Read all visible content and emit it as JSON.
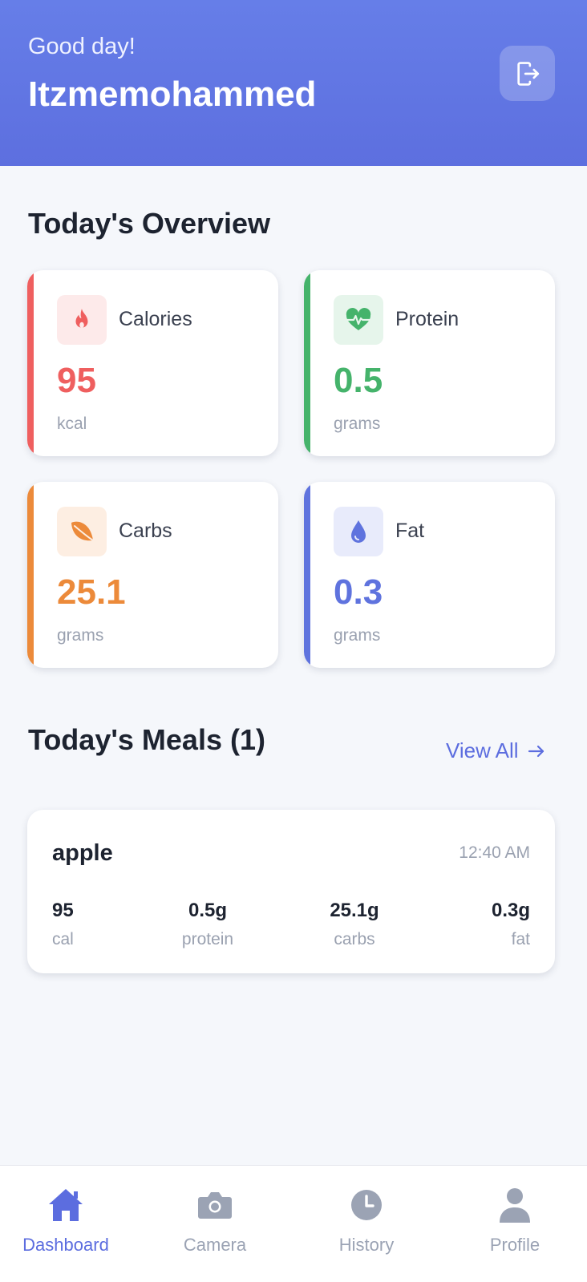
{
  "header": {
    "greeting": "Good day!",
    "username": "Itzmemohammed",
    "logout_icon": "logout-icon"
  },
  "overview": {
    "title": "Today's Overview",
    "cards": [
      {
        "label": "Calories",
        "value": "95",
        "unit": "kcal",
        "icon": "flame-icon",
        "color": "#ef5f5f"
      },
      {
        "label": "Protein",
        "value": "0.5",
        "unit": "grams",
        "icon": "heart-pulse-icon",
        "color": "#45b36b"
      },
      {
        "label": "Carbs",
        "value": "25.1",
        "unit": "grams",
        "icon": "leaf-icon",
        "color": "#ec8a3a"
      },
      {
        "label": "Fat",
        "value": "0.3",
        "unit": "grams",
        "icon": "droplet-icon",
        "color": "#5f73de"
      }
    ]
  },
  "meals": {
    "title": "Today's Meals (1)",
    "view_all": "View All",
    "items": [
      {
        "name": "apple",
        "time": "12:40 AM",
        "stats": [
          {
            "value": "95",
            "label": "cal"
          },
          {
            "value": "0.5g",
            "label": "protein"
          },
          {
            "value": "25.1g",
            "label": "carbs"
          },
          {
            "value": "0.3g",
            "label": "fat"
          }
        ]
      }
    ]
  },
  "nav": {
    "active": "Dashboard",
    "items": [
      {
        "label": "Dashboard",
        "icon": "home-icon"
      },
      {
        "label": "Camera",
        "icon": "camera-icon"
      },
      {
        "label": "History",
        "icon": "clock-icon"
      },
      {
        "label": "Profile",
        "icon": "user-icon"
      }
    ]
  },
  "colors": {
    "accent": "#5c6ddf",
    "header_gradient": [
      "#667ee8",
      "#5d6fdf"
    ],
    "background": "#f5f7fb"
  }
}
